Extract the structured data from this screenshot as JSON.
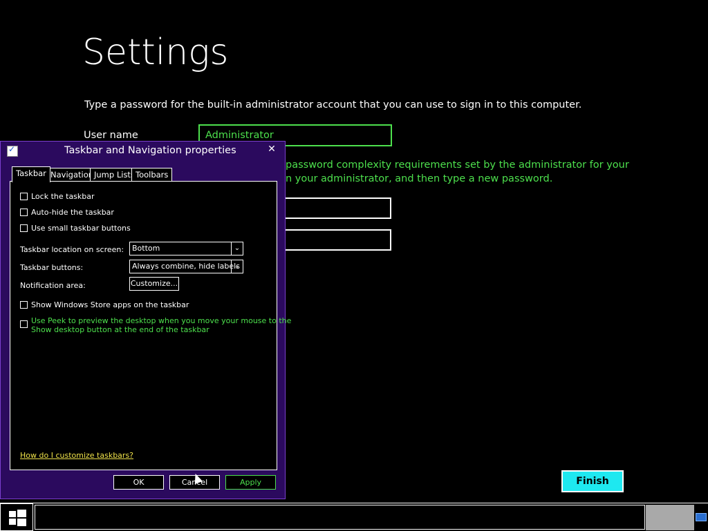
{
  "settings": {
    "title": "Settings",
    "description": "Type a password for the built-in administrator account that you can use to sign in to this computer.",
    "username_label": "User name",
    "username_value": "Administrator",
    "error_line1": "password complexity requirements set by the administrator for your",
    "error_line2": "n your administrator, and then type a new password.",
    "finish_label": "Finish"
  },
  "dialog": {
    "title": "Taskbar and Navigation properties",
    "close_glyph": "✕",
    "tabs": [
      "Taskbar",
      "Navigation",
      "Jump Lists",
      "Toolbars"
    ],
    "checkboxes": {
      "lock": "Lock the taskbar",
      "autohide": "Auto-hide the taskbar",
      "small": "Use small taskbar buttons",
      "store": "Show Windows Store apps on the taskbar",
      "peek_line1": "Use Peek to preview the desktop when you move your mouse to the",
      "peek_line2": "Show desktop button at the end of the taskbar"
    },
    "location_label": "Taskbar location on screen:",
    "location_value": "Bottom",
    "buttons_label": "Taskbar buttons:",
    "buttons_value": "Always combine, hide labels",
    "notification_label": "Notification area:",
    "customize_label": "Customize...",
    "help_link": "How do I customize taskbars?",
    "ok_label": "OK",
    "cancel_label": "Cancel",
    "apply_label": "Apply",
    "combo_arrow": "⌄"
  },
  "colors": {
    "accent_green": "#4de04d",
    "dialog_bg": "#2b0a5e",
    "finish_bg": "#1ee8f0",
    "link_yellow": "#f0e34a"
  }
}
